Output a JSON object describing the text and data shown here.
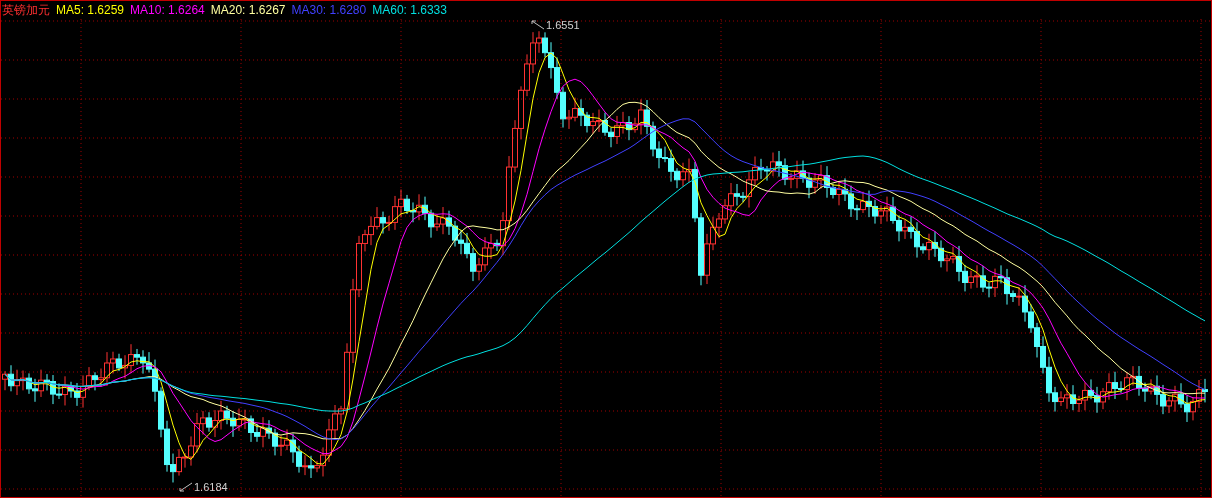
{
  "chart": {
    "title": "英镑加元",
    "moving_averages": [
      {
        "label": "MA5: 1.6259",
        "color": "#ffff00"
      },
      {
        "label": "MA10: 1.6264",
        "color": "#ff00ff"
      },
      {
        "label": "MA20: 1.6267",
        "color": "#ffffa0"
      },
      {
        "label": "MA30: 1.6280",
        "color": "#4040ff"
      },
      {
        "label": "MA60: 1.6333",
        "color": "#00e0e0"
      }
    ],
    "high_label": "1.6551",
    "low_label": "1.6184"
  }
}
